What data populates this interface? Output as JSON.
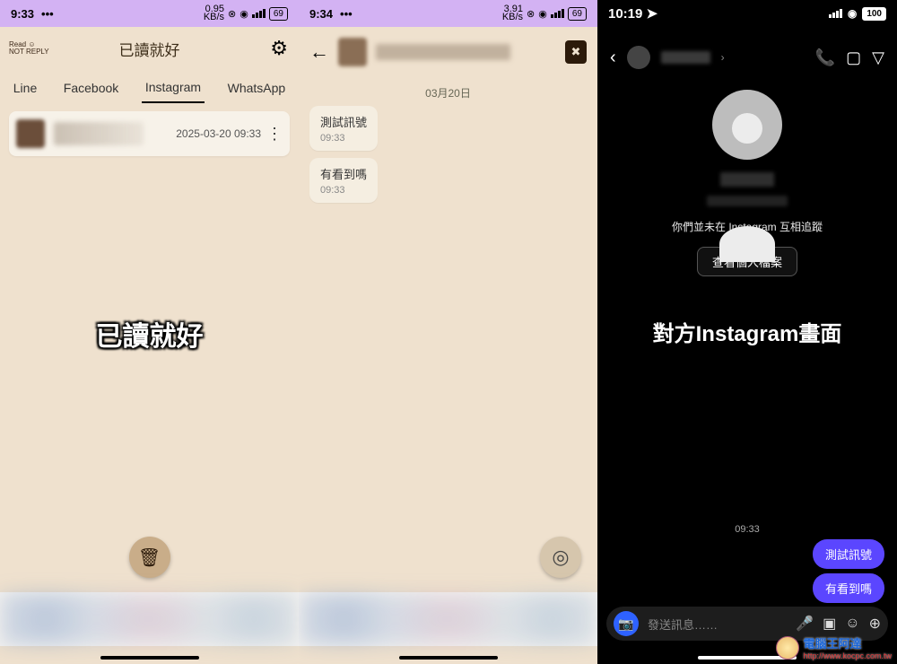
{
  "phone1": {
    "status_time": "9:33",
    "status_dots": "•••",
    "net_speed": "0.95\nKB/s",
    "battery": "69",
    "app_logo": "Read ☺\nNOT REPLY",
    "title": "已讀就好",
    "tabs": [
      "Line",
      "Facebook",
      "Instagram",
      "WhatsApp"
    ],
    "active_tab_index": 2,
    "card_timestamp": "2025-03-20 09:33",
    "overlay": "已讀就好"
  },
  "phone2": {
    "status_time": "9:34",
    "status_dots": "•••",
    "net_speed": "3.91\nKB/s",
    "battery": "69",
    "date_label": "03月20日",
    "messages": [
      {
        "text": "測試訊號",
        "time": "09:33"
      },
      {
        "text": "有看到嗎",
        "time": "09:33"
      }
    ]
  },
  "phone3": {
    "status_time": "10:19",
    "battery": "100",
    "follow_note": "你們並未在 Instagram 互相追蹤",
    "profile_button": "查看個人檔案",
    "overlay": "對方Instagram畫面",
    "chat_time": "09:33",
    "out_messages": [
      "測試訊號",
      "有看到嗎"
    ],
    "composer_placeholder": "發送訊息……"
  },
  "watermark": {
    "name": "電腦王阿達",
    "url": "http://www.kocpc.com.tw"
  }
}
